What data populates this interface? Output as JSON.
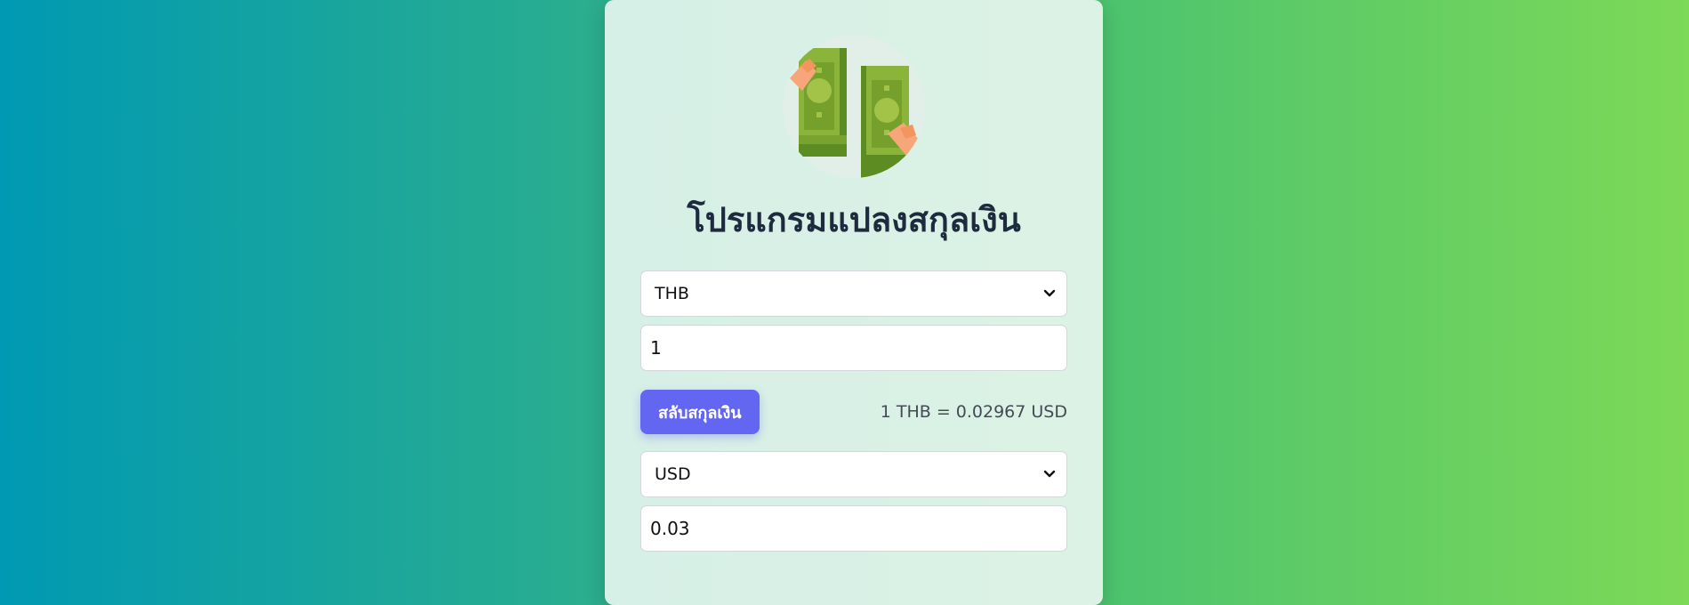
{
  "header": {
    "title": "โปรแกรมแปลงสกุลเงิน",
    "logo_icon": "money-bills-icon"
  },
  "from": {
    "currency": "THB",
    "amount": "1"
  },
  "swap": {
    "button_label": "สลับสกุลเงิน",
    "rate_text": "1 THB = 0.02967 USD"
  },
  "to": {
    "currency": "USD",
    "amount": "0.03"
  },
  "colors": {
    "accent": "#6366f1",
    "title": "#1e2b3e",
    "bill": "#6f9e2b",
    "hand": "#f7a67a"
  }
}
